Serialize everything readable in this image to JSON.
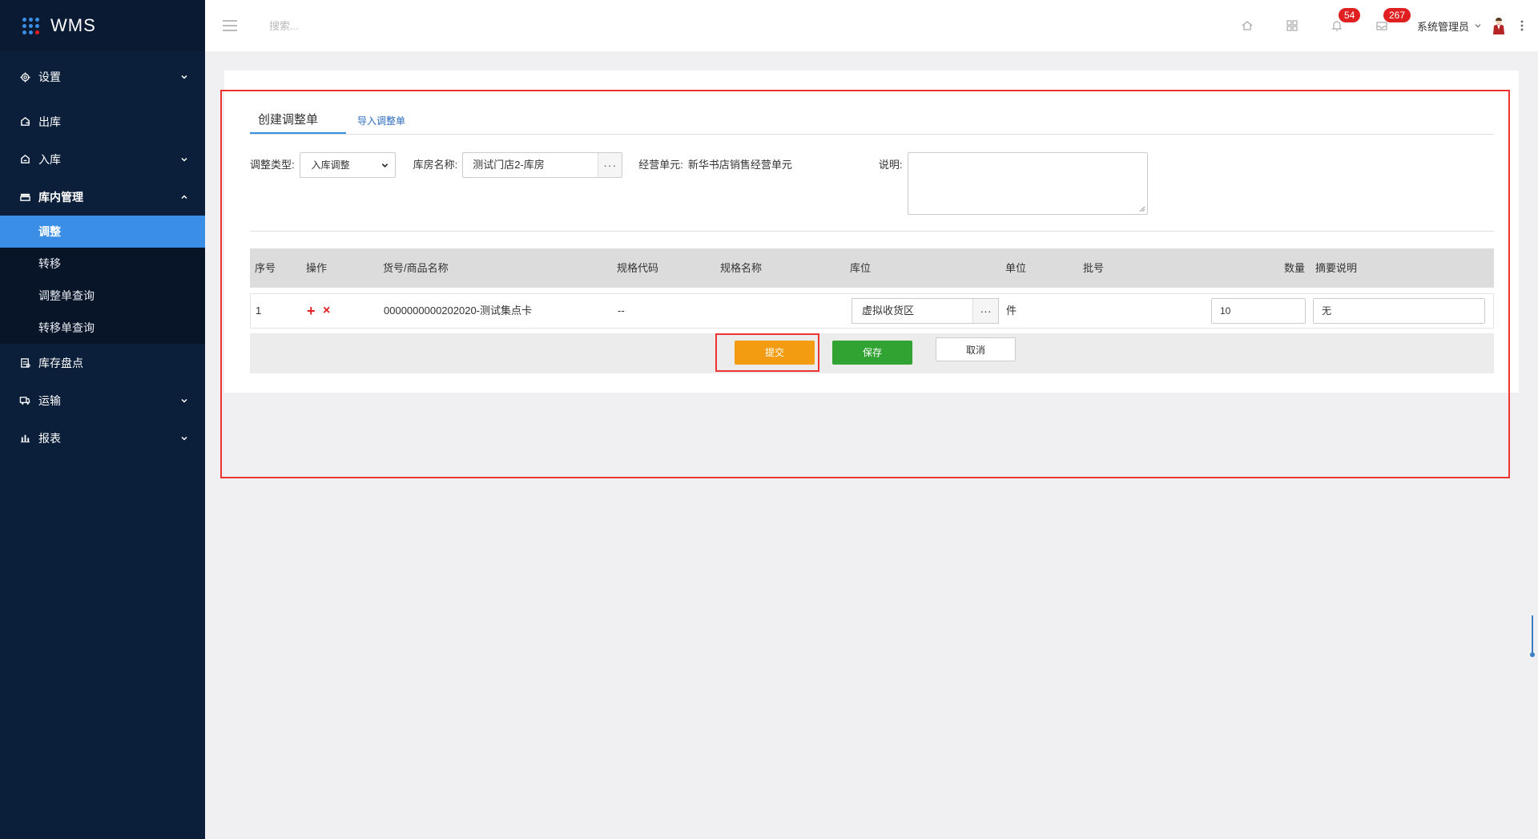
{
  "app": {
    "logo_text": "WMS"
  },
  "colors": {
    "sidebar_bg": "#0b1f3a",
    "active": "#3a8ee6",
    "submit": "#f39c12",
    "save": "#31a333",
    "badge": "#e02020"
  },
  "sidebar": {
    "items": [
      {
        "label": "设置",
        "icon": "gear-icon",
        "chevron": "down"
      },
      {
        "label": "出库",
        "icon": "outbound-icon"
      },
      {
        "label": "入库",
        "icon": "inbound-icon",
        "chevron": "down"
      },
      {
        "label": "库内管理",
        "icon": "warehouse-icon",
        "chevron": "up"
      },
      {
        "label": "库存盘点",
        "icon": "clipboard-icon"
      },
      {
        "label": "运输",
        "icon": "truck-icon",
        "chevron": "down"
      },
      {
        "label": "报表",
        "icon": "bar-chart-icon",
        "chevron": "down"
      }
    ],
    "submenu": [
      {
        "label": "调整",
        "active": true
      },
      {
        "label": "转移"
      },
      {
        "label": "调整单查询"
      },
      {
        "label": "转移单查询"
      }
    ]
  },
  "header": {
    "search_placeholder": "搜索...",
    "badges": {
      "notifications": "54",
      "messages": "267"
    },
    "user_name": "系统管理员"
  },
  "tabs": [
    {
      "label": "创建调整单"
    },
    {
      "label": "导入调整单"
    }
  ],
  "form": {
    "type_label": "调整类型:",
    "type_value": "入库调整",
    "warehouse_label": "库房名称:",
    "warehouse_value": "测试门店2-库房",
    "picker_dots": "···",
    "unit_label": "经营单元:",
    "unit_value": "新华书店销售经营单元",
    "note_label": "说明:"
  },
  "table": {
    "headers": [
      "序号",
      "操作",
      "货号/商品名称",
      "规格代码",
      "规格名称",
      "库位",
      "单位",
      "批号",
      "数量",
      "摘要说明"
    ],
    "rows": [
      {
        "index": "1",
        "add": "+",
        "remove": "×",
        "product": "0000000000202020-测试集点卡",
        "spec_code": "--",
        "location": "虚拟收货区",
        "unit": "件",
        "quantity": "10",
        "summary": "无"
      }
    ]
  },
  "actions": {
    "submit": "提交",
    "save": "保存",
    "cancel": "取消"
  }
}
